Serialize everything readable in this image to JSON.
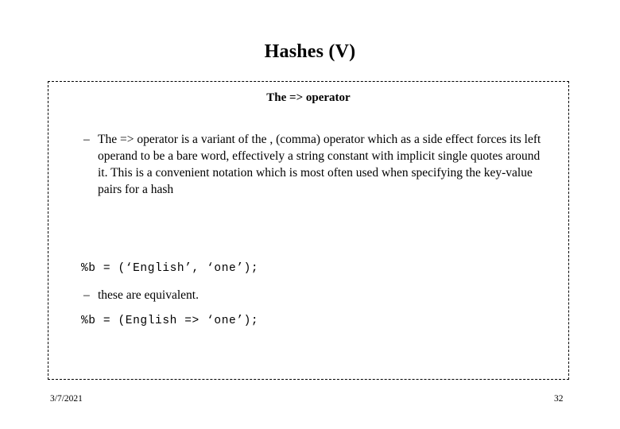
{
  "slide": {
    "title": "Hashes (V)",
    "subtitle": "The  => operator",
    "bullets": [
      {
        "marker": "–",
        "text": "The =>  operator is a variant of the , (comma) operator which as a side effect forces its left operand to be a bare word, effectively a string constant with implicit single quotes around it. This is a convenient notation which is most often used when specifying the key-value pairs for a hash"
      }
    ],
    "code_lines": [
      "%b = (‘English’, ‘one’);",
      "%b = (English => ‘one’);"
    ],
    "bullets_after_code": [
      {
        "marker": "–",
        "text": "these are equivalent."
      }
    ],
    "footer": {
      "date": "3/7/2021",
      "page_number": "32"
    },
    "colors": {
      "background": "#ffffff",
      "text": "#000000",
      "border": "#000000"
    }
  }
}
